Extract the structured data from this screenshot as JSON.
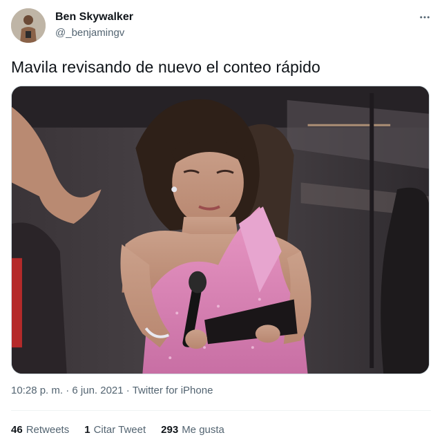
{
  "author": {
    "display_name": "Ben Skywalker",
    "handle": "@_benjamingv"
  },
  "tweet": {
    "text": "Mavila revisando de nuevo el conteo rápido"
  },
  "meta": {
    "time": "10:28 p. m.",
    "separator1": " · ",
    "date": "6 jun. 2021",
    "separator2": " · ",
    "source": "Twitter for iPhone"
  },
  "stats": {
    "retweets_count": "46",
    "retweets_label": "Retweets",
    "quotes_count": "1",
    "quotes_label": "Citar Tweet",
    "likes_count": "293",
    "likes_label": "Me gusta"
  },
  "icons": {
    "more": "more-horizontal-icon"
  },
  "colors": {
    "text_primary": "#0f1419",
    "text_secondary": "#536471",
    "divider": "#eff3f4"
  }
}
